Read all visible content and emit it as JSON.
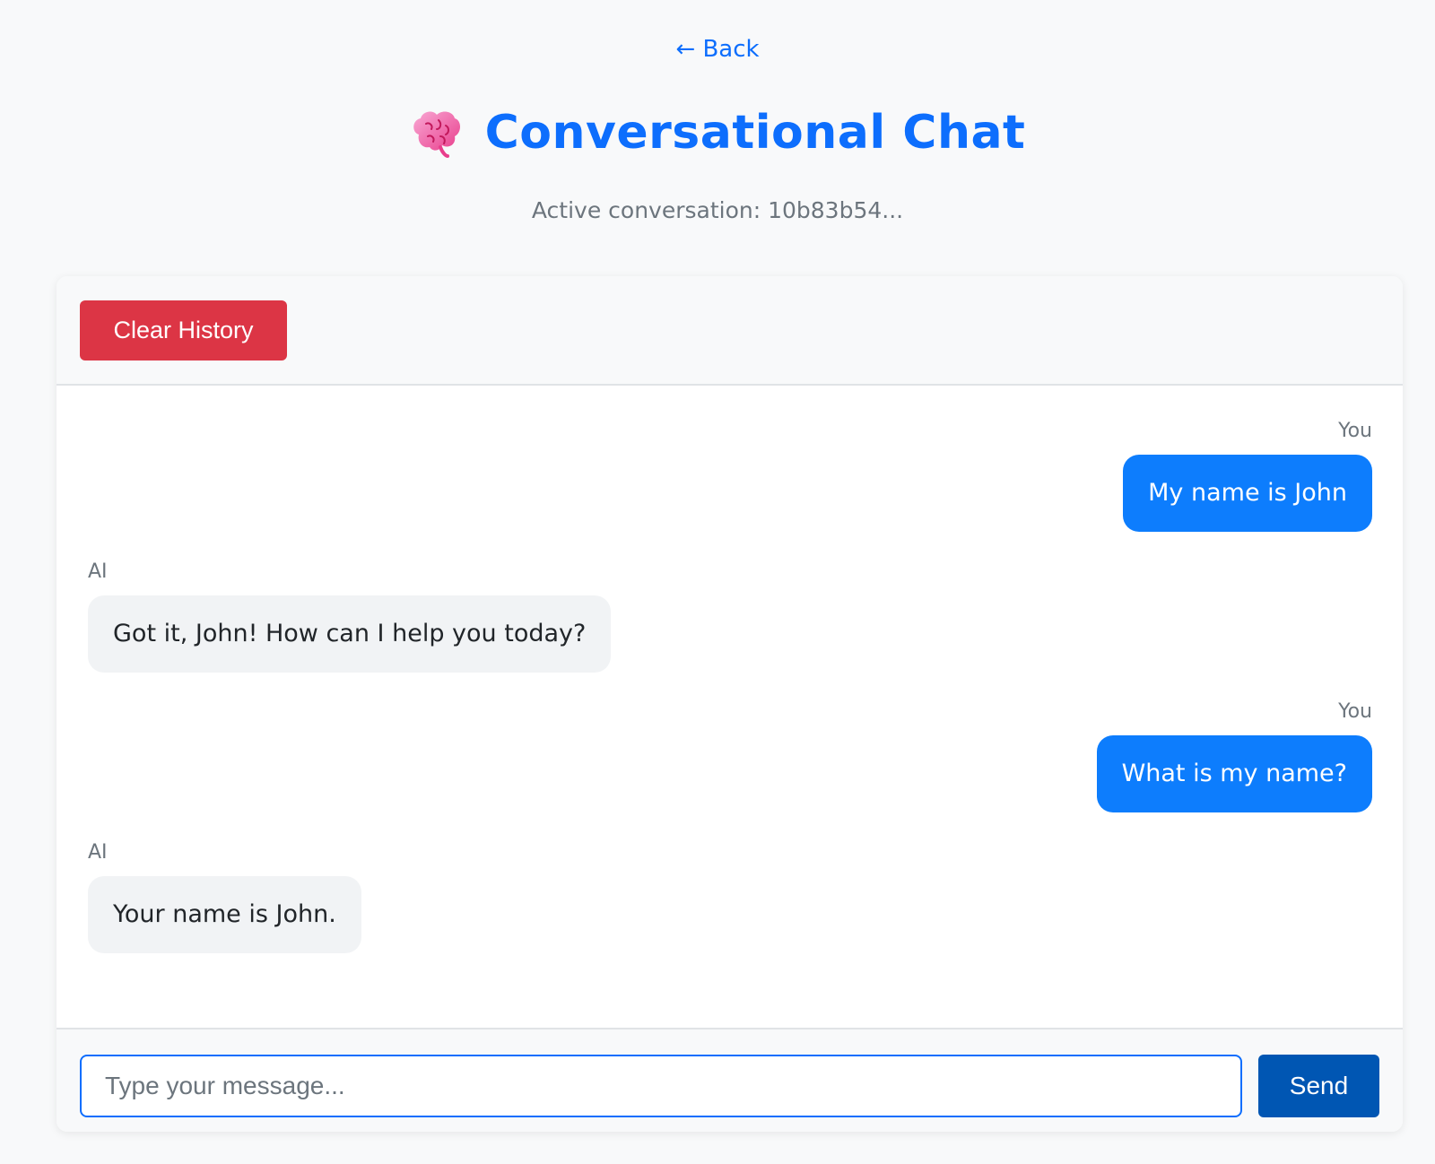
{
  "nav": {
    "back_label": "← Back"
  },
  "header": {
    "icon": "brain-icon",
    "title": "Conversational Chat",
    "subtitle": "Active conversation: 10b83b54..."
  },
  "toolbar": {
    "clear_label": "Clear History"
  },
  "messages": [
    {
      "sender": "You",
      "role": "user",
      "text": "My name is John"
    },
    {
      "sender": "AI",
      "role": "ai",
      "text": "Got it, John! How can I help you today?"
    },
    {
      "sender": "You",
      "role": "user",
      "text": "What is my name?"
    },
    {
      "sender": "AI",
      "role": "ai",
      "text": "Your name is John."
    }
  ],
  "composer": {
    "placeholder": "Type your message...",
    "value": "",
    "send_label": "Send"
  },
  "colors": {
    "accent": "#0d6efd",
    "user_bubble": "#0d7dfd",
    "ai_bubble": "#f1f3f5",
    "danger": "#dc3545",
    "send": "#0056b3"
  }
}
